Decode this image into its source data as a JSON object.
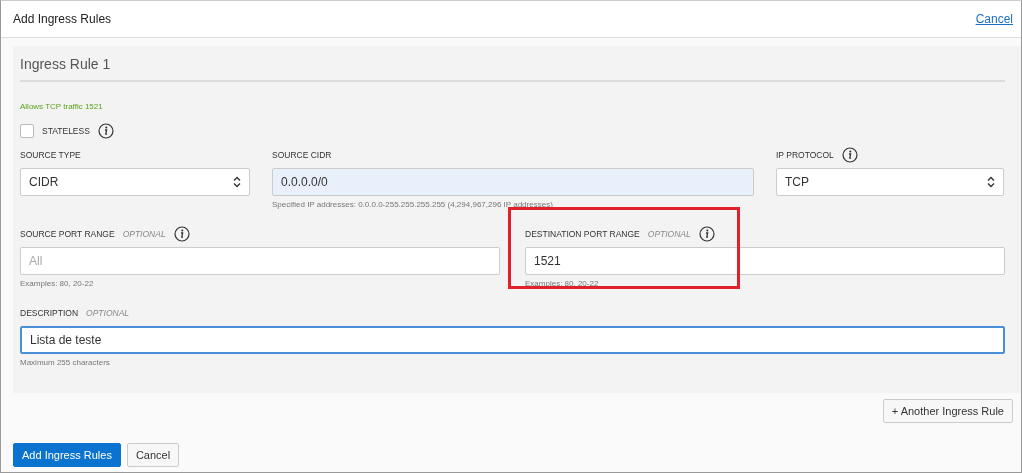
{
  "window": {
    "title": "Add Ingress Rules",
    "cancel_link": "Cancel"
  },
  "rule": {
    "title": "Ingress Rule 1",
    "summary": "Allows TCP traffic 1521",
    "stateless": {
      "label": "STATELESS",
      "checked": false,
      "info": true
    },
    "rows": [
      [
        {
          "kind": "select",
          "label": "SOURCE TYPE",
          "value": "CIDR"
        },
        {
          "kind": "input",
          "label": "SOURCE CIDR",
          "value": "0.0.0.0/0",
          "autofilled": true,
          "hint": "Specified IP addresses: 0.0.0.0-255.255.255.255 (4,294,967,296 IP addresses)"
        },
        {
          "kind": "select",
          "label": "IP PROTOCOL",
          "info": true,
          "value": "TCP"
        }
      ],
      [
        {
          "kind": "input",
          "label": "SOURCE PORT RANGE",
          "optional": "OPTIONAL",
          "info": true,
          "placeholder": "All",
          "hint": "Examples: 80, 20-22"
        },
        {
          "kind": "input",
          "label": "DESTINATION PORT RANGE",
          "optional": "OPTIONAL",
          "info": true,
          "value": "1521",
          "hint": "Examples: 80, 20-22",
          "highlighted": true
        }
      ],
      [
        {
          "kind": "input",
          "label": "DESCRIPTION",
          "optional": "OPTIONAL",
          "value": "Lista de teste",
          "focused": true,
          "hint": "Maximum 255 characters"
        }
      ]
    ]
  },
  "another_rule_button": "+ Another Ingress Rule",
  "buttons": [
    {
      "label": "Add Ingress Rules",
      "primary": true
    },
    {
      "label": "Cancel",
      "primary": false
    }
  ]
}
